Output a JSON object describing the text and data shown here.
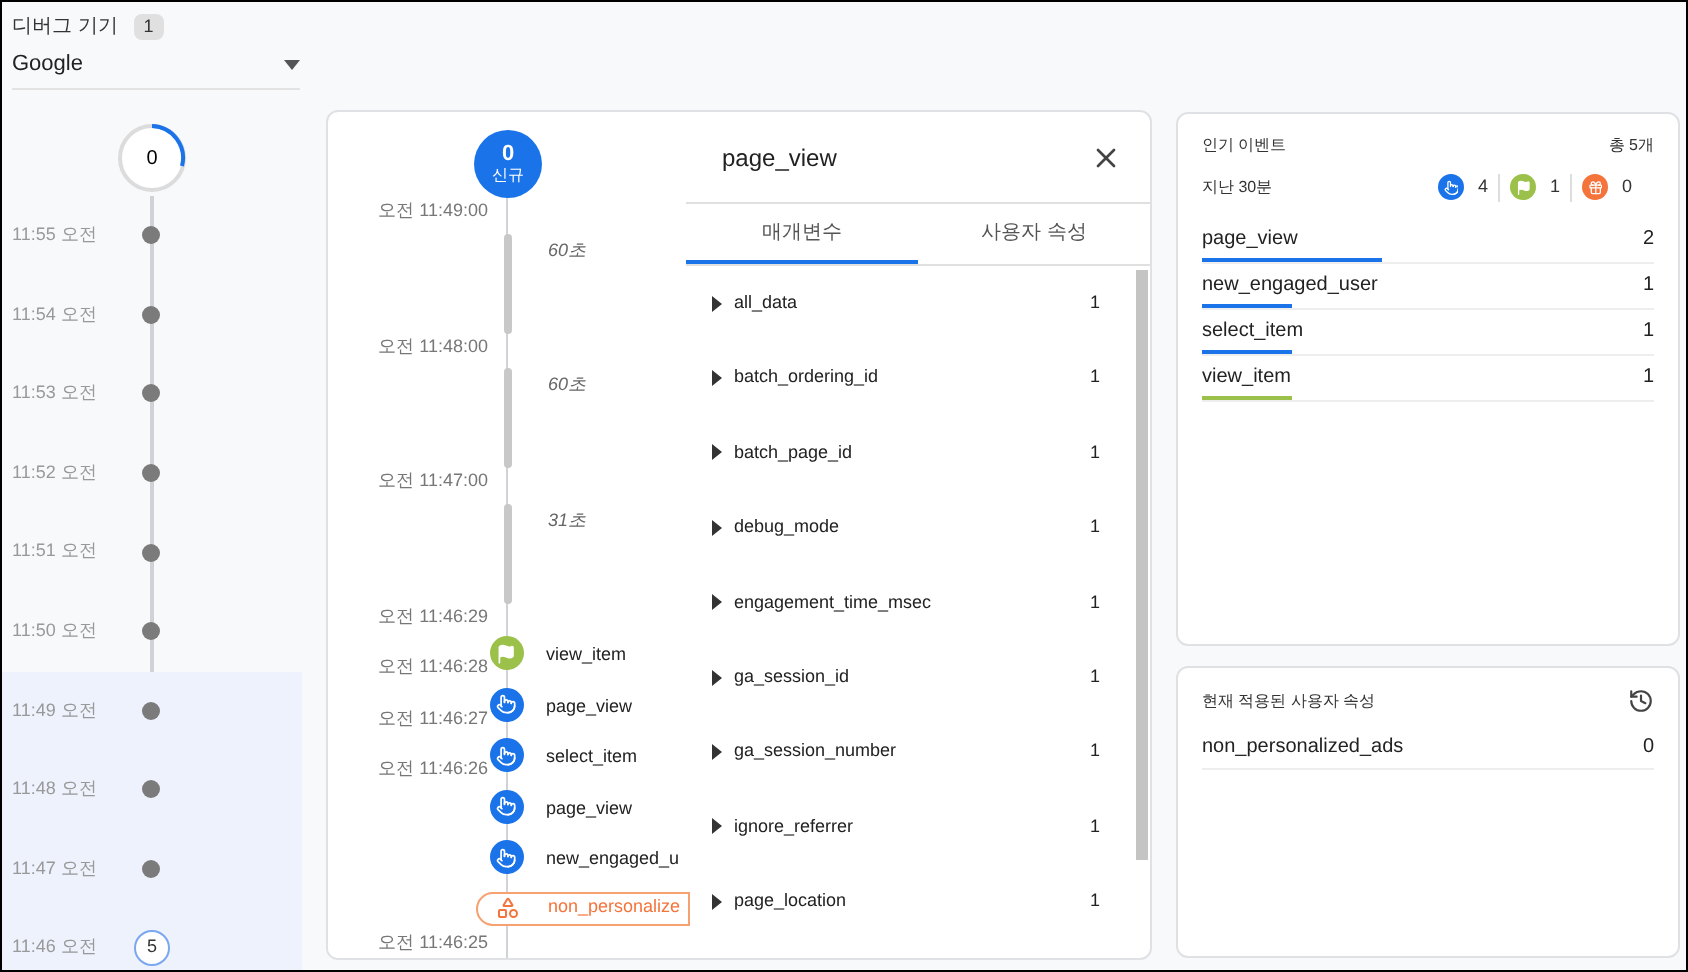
{
  "device": {
    "label": "디버그 기기",
    "count": "1",
    "selected": "Google"
  },
  "minutes": {
    "top_count": "0",
    "rows": [
      {
        "time": "11:55 오전",
        "highlighted": false
      },
      {
        "time": "11:54 오전",
        "highlighted": false
      },
      {
        "time": "11:53 오전",
        "highlighted": false
      },
      {
        "time": "11:52 오전",
        "highlighted": false
      },
      {
        "time": "11:51 오전",
        "highlighted": false
      },
      {
        "time": "11:50 오전",
        "highlighted": false
      },
      {
        "time": "11:49 오전",
        "highlighted": true
      },
      {
        "time": "11:48 오전",
        "highlighted": true
      },
      {
        "time": "11:47 오전",
        "highlighted": true
      },
      {
        "time": "11:46 오전",
        "highlighted": true,
        "count": "5"
      }
    ]
  },
  "stream": {
    "badge_count": "0",
    "badge_label": "신규",
    "items": [
      {
        "kind": "time",
        "text": "오전 11:49:00"
      },
      {
        "kind": "gap",
        "text": "60초"
      },
      {
        "kind": "time",
        "text": "오전 11:48:00"
      },
      {
        "kind": "gap",
        "text": "60초"
      },
      {
        "kind": "time",
        "text": "오전 11:47:00"
      },
      {
        "kind": "gap",
        "text": "31초"
      },
      {
        "kind": "time",
        "text": "오전 11:46:29"
      },
      {
        "kind": "conversion",
        "name": "view_item",
        "time": "오전 11:46:28"
      },
      {
        "kind": "click",
        "name": "page_view",
        "time": "오전 11:46:27"
      },
      {
        "kind": "click",
        "name": "select_item",
        "time": "오전 11:46:26"
      },
      {
        "kind": "click",
        "name": "page_view"
      },
      {
        "kind": "click",
        "name": "new_engaged_u"
      },
      {
        "kind": "property",
        "name": "non_personalize"
      },
      {
        "kind": "time",
        "text": "오전 11:46:25"
      }
    ]
  },
  "detail": {
    "title": "page_view",
    "tabs": [
      {
        "label": "매개변수",
        "selected": true
      },
      {
        "label": "사용자 속성",
        "selected": false
      }
    ],
    "params": [
      {
        "name": "all_data",
        "count": "1"
      },
      {
        "name": "batch_ordering_id",
        "count": "1"
      },
      {
        "name": "batch_page_id",
        "count": "1"
      },
      {
        "name": "debug_mode",
        "count": "1"
      },
      {
        "name": "engagement_time_msec",
        "count": "1"
      },
      {
        "name": "ga_session_id",
        "count": "1"
      },
      {
        "name": "ga_session_number",
        "count": "1"
      },
      {
        "name": "ignore_referrer",
        "count": "1"
      },
      {
        "name": "page_location",
        "count": "1"
      }
    ]
  },
  "top_events": {
    "title": "인기 이벤트",
    "total": "총 5개",
    "period": "지난 30분",
    "counts": [
      {
        "kind": "click",
        "count": "4"
      },
      {
        "kind": "conversion",
        "count": "1"
      },
      {
        "kind": "error",
        "count": "0"
      }
    ],
    "events": [
      {
        "name": "page_view",
        "count": "2",
        "level": 0.4,
        "color": "#1a73e8"
      },
      {
        "name": "new_engaged_user",
        "count": "1",
        "level": 0.2,
        "color": "#1a73e8"
      },
      {
        "name": "select_item",
        "count": "1",
        "level": 0.2,
        "color": "#1a73e8"
      },
      {
        "name": "view_item",
        "count": "1",
        "level": 0.2,
        "color": "#9bc14a"
      }
    ]
  },
  "user_properties": {
    "title": "현재 적용된 사용자 속성",
    "items": [
      {
        "name": "non_personalized_ads",
        "value": "0"
      }
    ]
  }
}
